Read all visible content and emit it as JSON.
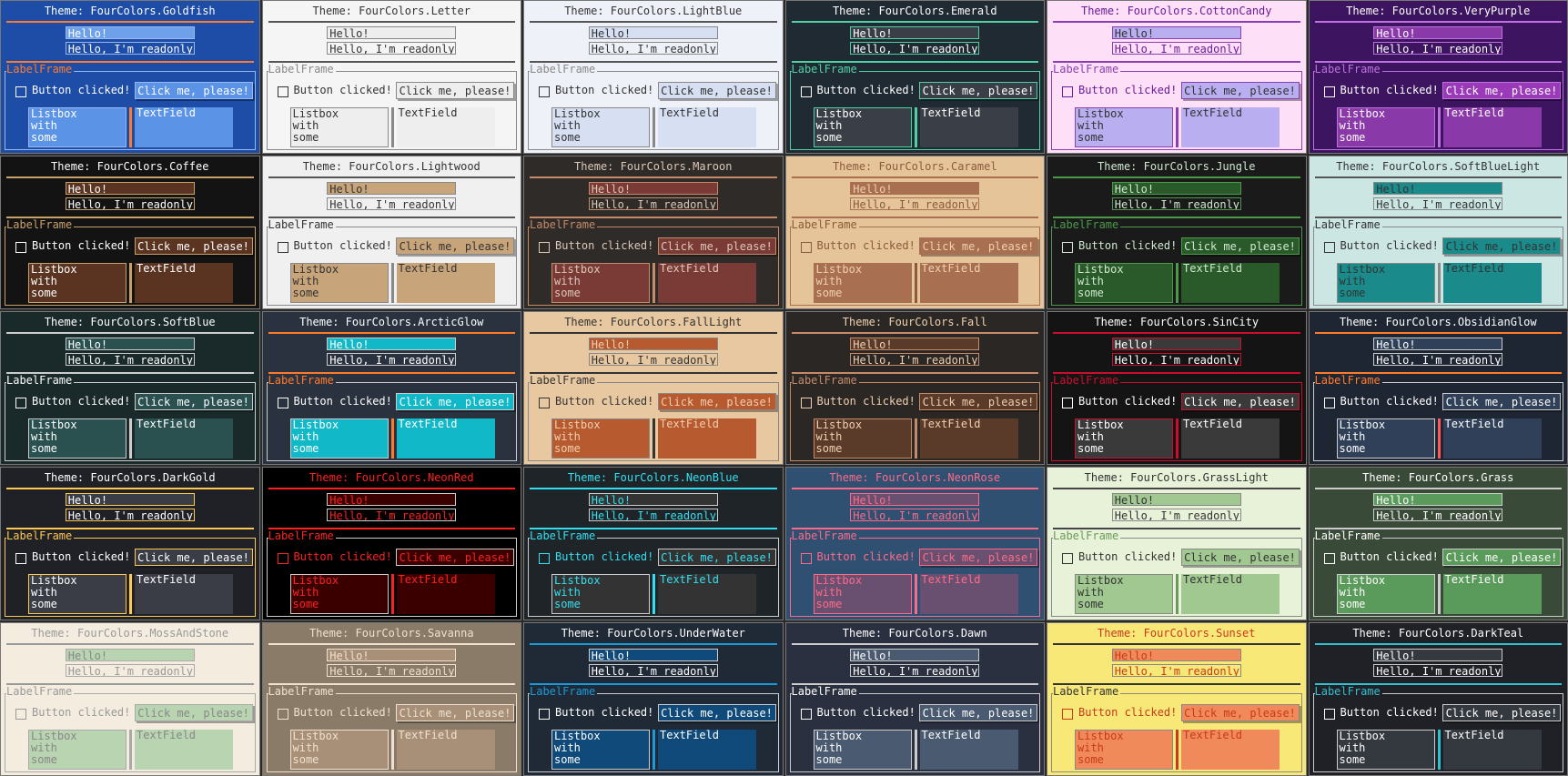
{
  "labels": {
    "title_prefix": "Theme: ",
    "hello": "Hello!",
    "readonly": "Hello, I'm readonly!",
    "label_frame": "LabelFrame",
    "checkbox": "Button clicked!",
    "button": "Click me, please!",
    "listbox_items": [
      "Listbox",
      "with",
      "some"
    ],
    "textfield": "TextField"
  },
  "themes": [
    {
      "name": "FourColors.Goldfish",
      "bg": "#1e4da8",
      "fg": "#ffffff",
      "accent": "#ff7a2a",
      "entry_bg": "#6fa0ea",
      "entry_fg": "#ffffff",
      "btn_bg": "#5b93e6",
      "btn_fg": "#ffffff",
      "list_bg": "#5b93e6",
      "list_fg": "#ffffff",
      "text_bg": "#5b93e6",
      "text_fg": "#ffffff",
      "frame": "#9ab8f0",
      "label": "#ff7a2a",
      "sep": "#ff7a2a"
    },
    {
      "name": "FourColors.Letter",
      "bg": "#f5f5f5",
      "fg": "#333333",
      "accent": "#555555",
      "entry_bg": "#eeeeee",
      "entry_fg": "#333333",
      "btn_bg": "#eeeeee",
      "btn_fg": "#333333",
      "list_bg": "#eeeeee",
      "list_fg": "#333333",
      "text_bg": "#eeeeee",
      "text_fg": "#333333",
      "frame": "#888888",
      "label": "#888888",
      "sep": "#888888"
    },
    {
      "name": "FourColors.LightBlue",
      "bg": "#eef1f8",
      "fg": "#333333",
      "accent": "#555555",
      "entry_bg": "#d6e0f2",
      "entry_fg": "#333333",
      "btn_bg": "#d6e0f2",
      "btn_fg": "#333333",
      "list_bg": "#d6e0f2",
      "list_fg": "#333333",
      "text_bg": "#d6e0f2",
      "text_fg": "#333333",
      "frame": "#888888",
      "label": "#888888",
      "sep": "#888888"
    },
    {
      "name": "FourColors.Emerald",
      "bg": "#1f2a33",
      "fg": "#ffffff",
      "accent": "#4fd1a5",
      "entry_bg": "#3a3f47",
      "entry_fg": "#ffffff",
      "btn_bg": "#3a3f47",
      "btn_fg": "#ffffff",
      "list_bg": "#3a3f47",
      "list_fg": "#ffffff",
      "text_bg": "#3a3f47",
      "text_fg": "#ffffff",
      "frame": "#4fd1a5",
      "label": "#4fd1a5",
      "sep": "#4fd1a5"
    },
    {
      "name": "FourColors.CottonCandy",
      "bg": "#fde0f8",
      "fg": "#6a1b9a",
      "accent": "#8a3fb0",
      "entry_bg": "#b8aef0",
      "entry_fg": "#333333",
      "btn_bg": "#b8aef0",
      "btn_fg": "#333333",
      "list_bg": "#b8aef0",
      "list_fg": "#333333",
      "text_bg": "#b8aef0",
      "text_fg": "#333333",
      "frame": "#8a3fb0",
      "label": "#8a3fb0",
      "sep": "#8a3fb0"
    },
    {
      "name": "FourColors.VeryPurple",
      "bg": "#3c1460",
      "fg": "#ffffff",
      "accent": "#c070e0",
      "entry_bg": "#8a3aa8",
      "entry_fg": "#ffffff",
      "btn_bg": "#9a3ab8",
      "btn_fg": "#ffffff",
      "list_bg": "#8a3aa8",
      "list_fg": "#ffffff",
      "text_bg": "#8a3aa8",
      "text_fg": "#ffffff",
      "frame": "#c070e0",
      "label": "#c070e0",
      "sep": "#c070e0"
    },
    {
      "name": "FourColors.Coffee",
      "bg": "#131313",
      "fg": "#ffffff",
      "accent": "#c8a06a",
      "entry_bg": "#5a3420",
      "entry_fg": "#ffffff",
      "btn_bg": "#5a3420",
      "btn_fg": "#ffffff",
      "list_bg": "#5a3420",
      "list_fg": "#ffffff",
      "text_bg": "#5a3420",
      "text_fg": "#ffffff",
      "frame": "#c8a06a",
      "label": "#c8a06a",
      "sep": "#c8a06a"
    },
    {
      "name": "FourColors.Lightwood",
      "bg": "#f0f0f0",
      "fg": "#333333",
      "accent": "#555555",
      "entry_bg": "#c8a47a",
      "entry_fg": "#333333",
      "btn_bg": "#c8a47a",
      "btn_fg": "#333333",
      "list_bg": "#c8a47a",
      "list_fg": "#333333",
      "text_bg": "#c8a47a",
      "text_fg": "#333333",
      "frame": "#888888",
      "label": "#333333",
      "sep": "#888888"
    },
    {
      "name": "FourColors.Maroon",
      "bg": "#2f2b28",
      "fg": "#dcc8b8",
      "accent": "#c48a6a",
      "entry_bg": "#7a3a36",
      "entry_fg": "#dcc8b8",
      "btn_bg": "#7a3a36",
      "btn_fg": "#dcc8b8",
      "list_bg": "#7a3a36",
      "list_fg": "#dcc8b8",
      "text_bg": "#7a3a36",
      "text_fg": "#dcc8b8",
      "frame": "#c48a6a",
      "label": "#c48a6a",
      "sep": "#c48a6a"
    },
    {
      "name": "FourColors.Caramel",
      "bg": "#e6c49a",
      "fg": "#8a5a3a",
      "accent": "#a87050",
      "entry_bg": "#a87050",
      "entry_fg": "#f0d0b0",
      "btn_bg": "#a87050",
      "btn_fg": "#f0d0b0",
      "list_bg": "#a87050",
      "list_fg": "#f0d0b0",
      "text_bg": "#a87050",
      "text_fg": "#f0d0b0",
      "frame": "#a87050",
      "label": "#8a5a3a",
      "sep": "#8a5a3a"
    },
    {
      "name": "FourColors.Jungle",
      "bg": "#1a1a1a",
      "fg": "#cfe8cf",
      "accent": "#4a9a4a",
      "entry_bg": "#2a5a2a",
      "entry_fg": "#cfe8cf",
      "btn_bg": "#2a5a2a",
      "btn_fg": "#cfe8cf",
      "list_bg": "#2a5a2a",
      "list_fg": "#cfe8cf",
      "text_bg": "#2a5a2a",
      "text_fg": "#cfe8cf",
      "frame": "#4a9a4a",
      "label": "#4a9a4a",
      "sep": "#4a9a4a"
    },
    {
      "name": "FourColors.SoftBlueLight",
      "bg": "#cce6e4",
      "fg": "#333333",
      "accent": "#555555",
      "entry_bg": "#1a8a8a",
      "entry_fg": "#333333",
      "btn_bg": "#1a8a8a",
      "btn_fg": "#333333",
      "list_bg": "#1a8a8a",
      "list_fg": "#333333",
      "text_bg": "#1a8a8a",
      "text_fg": "#333333",
      "frame": "#888888",
      "label": "#333333",
      "sep": "#888888"
    },
    {
      "name": "FourColors.SoftBlue",
      "bg": "#1a2a2a",
      "fg": "#ffffff",
      "accent": "#cccccc",
      "entry_bg": "#2a5050",
      "entry_fg": "#ffffff",
      "btn_bg": "#2a5050",
      "btn_fg": "#ffffff",
      "list_bg": "#2a5050",
      "list_fg": "#ffffff",
      "text_bg": "#2a5050",
      "text_fg": "#ffffff",
      "frame": "#cccccc",
      "label": "#ffffff",
      "sep": "#cccccc"
    },
    {
      "name": "FourColors.ArcticGlow",
      "bg": "#2a3240",
      "fg": "#ffffff",
      "accent": "#ff7a2a",
      "entry_bg": "#10b8c8",
      "entry_fg": "#ffffff",
      "btn_bg": "#10b8c8",
      "btn_fg": "#ffffff",
      "list_bg": "#10b8c8",
      "list_fg": "#ffffff",
      "text_bg": "#10b8c8",
      "text_fg": "#ffffff",
      "frame": "#cccccc",
      "label": "#ff7a2a",
      "sep": "#ff7a2a"
    },
    {
      "name": "FourColors.FallLight",
      "bg": "#e8c8a0",
      "fg": "#333333",
      "accent": "#333333",
      "entry_bg": "#b85a30",
      "entry_fg": "#f0d0b0",
      "btn_bg": "#b85a30",
      "btn_fg": "#f0d0b0",
      "list_bg": "#b85a30",
      "list_fg": "#f0d0b0",
      "text_bg": "#b85a30",
      "text_fg": "#f0d0b0",
      "frame": "#888888",
      "label": "#333333",
      "sep": "#333333"
    },
    {
      "name": "FourColors.Fall",
      "bg": "#2b2724",
      "fg": "#f0d0b0",
      "accent": "#c48a6a",
      "entry_bg": "#5a3a28",
      "entry_fg": "#f0d0b0",
      "btn_bg": "#5a3a28",
      "btn_fg": "#f0d0b0",
      "list_bg": "#5a3a28",
      "list_fg": "#f0d0b0",
      "text_bg": "#5a3a28",
      "text_fg": "#f0d0b0",
      "frame": "#c48a6a",
      "label": "#c48a6a",
      "sep": "#c48a6a"
    },
    {
      "name": "FourColors.SinCity",
      "bg": "#141414",
      "fg": "#ffffff",
      "accent": "#c8102e",
      "entry_bg": "#3a3a3a",
      "entry_fg": "#ffffff",
      "btn_bg": "#3a3a3a",
      "btn_fg": "#ffffff",
      "list_bg": "#3a3a3a",
      "list_fg": "#ffffff",
      "text_bg": "#3a3a3a",
      "text_fg": "#ffffff",
      "frame": "#c8102e",
      "label": "#c8102e",
      "sep": "#c8102e"
    },
    {
      "name": "FourColors.ObsidianGlow",
      "bg": "#1f2633",
      "fg": "#ffffff",
      "accent": "#ff7a2a",
      "entry_bg": "#2f4058",
      "entry_fg": "#ffffff",
      "btn_bg": "#2f4058",
      "btn_fg": "#ffffff",
      "list_bg": "#2f4058",
      "list_fg": "#ffffff",
      "text_bg": "#2f4058",
      "text_fg": "#ffffff",
      "frame": "#cccccc",
      "label": "#ff7a2a",
      "sep": "#ff5a5a"
    },
    {
      "name": "FourColors.DarkGold",
      "bg": "#1f2126",
      "fg": "#ffffff",
      "accent": "#ffc850",
      "entry_bg": "#3a3d45",
      "entry_fg": "#ffffff",
      "btn_bg": "#3a3d45",
      "btn_fg": "#ffffff",
      "list_bg": "#3a3d45",
      "list_fg": "#ffffff",
      "text_bg": "#3a3d45",
      "text_fg": "#ffffff",
      "frame": "#ffc850",
      "label": "#ffc850",
      "sep": "#ffc850"
    },
    {
      "name": "FourColors.NeonRed",
      "bg": "#000000",
      "fg": "#ff2020",
      "accent": "#ff2020",
      "entry_bg": "#3a0000",
      "entry_fg": "#ff2020",
      "btn_bg": "#3a0000",
      "btn_fg": "#ff2020",
      "list_bg": "#3a0000",
      "list_fg": "#ff2020",
      "text_bg": "#3a0000",
      "text_fg": "#ff2020",
      "frame": "#cccccc",
      "label": "#ff2020",
      "sep": "#ff2020"
    },
    {
      "name": "FourColors.NeonBlue",
      "bg": "#1f2429",
      "fg": "#30e0f0",
      "accent": "#30e0f0",
      "entry_bg": "#333333",
      "entry_fg": "#30e0f0",
      "btn_bg": "#333333",
      "btn_fg": "#30e0f0",
      "list_bg": "#333333",
      "list_fg": "#30e0f0",
      "text_bg": "#333333",
      "text_fg": "#30e0f0",
      "frame": "#cccccc",
      "label": "#30e0f0",
      "sep": "#30e0f0"
    },
    {
      "name": "FourColors.NeonRose",
      "bg": "#2f5070",
      "fg": "#ff6a8a",
      "accent": "#ff6a8a",
      "entry_bg": "#6a5070",
      "entry_fg": "#ff6a8a",
      "btn_bg": "#6a5070",
      "btn_fg": "#ff6a8a",
      "list_bg": "#6a5070",
      "list_fg": "#ff6a8a",
      "text_bg": "#6a5070",
      "text_fg": "#ff6a8a",
      "frame": "#ff6a8a",
      "label": "#ff6a8a",
      "sep": "#ff6a8a"
    },
    {
      "name": "FourColors.GrassLight",
      "bg": "#e8f2d8",
      "fg": "#333333",
      "accent": "#444444",
      "entry_bg": "#a0c890",
      "entry_fg": "#333333",
      "btn_bg": "#a0c890",
      "btn_fg": "#333333",
      "list_bg": "#a0c890",
      "list_fg": "#333333",
      "text_bg": "#a0c890",
      "text_fg": "#333333",
      "frame": "#888888",
      "label": "#6a9a5a",
      "sep": "#6a9a5a"
    },
    {
      "name": "FourColors.Grass",
      "bg": "#3a4a38",
      "fg": "#ffffff",
      "accent": "#cccccc",
      "entry_bg": "#5a9a5a",
      "entry_fg": "#ffffff",
      "btn_bg": "#5a9a5a",
      "btn_fg": "#ffffff",
      "list_bg": "#5a9a5a",
      "list_fg": "#ffffff",
      "text_bg": "#5a9a5a",
      "text_fg": "#ffffff",
      "frame": "#cccccc",
      "label": "#ffffff",
      "sep": "#cccccc"
    },
    {
      "name": "FourColors.MossAndStone",
      "bg": "#f5ece0",
      "fg": "#999999",
      "accent": "#999999",
      "entry_bg": "#b8d4b0",
      "entry_fg": "#888888",
      "btn_bg": "#b8d4b0",
      "btn_fg": "#888888",
      "list_bg": "#b8d4b0",
      "list_fg": "#888888",
      "text_bg": "#b8d4b0",
      "text_fg": "#888888",
      "frame": "#aaaaaa",
      "label": "#999999",
      "sep": "#aaaaaa"
    },
    {
      "name": "FourColors.Savanna",
      "bg": "#8a7a68",
      "fg": "#f0e0d0",
      "accent": "#f0e0d0",
      "entry_bg": "#a89078",
      "entry_fg": "#f0e0d0",
      "btn_bg": "#a89078",
      "btn_fg": "#f0e0d0",
      "list_bg": "#a89078",
      "list_fg": "#f0e0d0",
      "text_bg": "#a89078",
      "text_fg": "#f0e0d0",
      "frame": "#f0e0d0",
      "label": "#f0e0d0",
      "sep": "#f0e0d0"
    },
    {
      "name": "FourColors.UnderWater",
      "bg": "#1f2a36",
      "fg": "#ffffff",
      "accent": "#1a9ad8",
      "entry_bg": "#0f4a7a",
      "entry_fg": "#ffffff",
      "btn_bg": "#0f4a7a",
      "btn_fg": "#ffffff",
      "list_bg": "#0f4a7a",
      "list_fg": "#ffffff",
      "text_bg": "#0f4a7a",
      "text_fg": "#ffffff",
      "frame": "#cccccc",
      "label": "#1a9ad8",
      "sep": "#1a9ad8"
    },
    {
      "name": "FourColors.Dawn",
      "bg": "#2a3040",
      "fg": "#ffffff",
      "accent": "#cccccc",
      "entry_bg": "#4a5a70",
      "entry_fg": "#ffffff",
      "btn_bg": "#4a5a70",
      "btn_fg": "#ffffff",
      "list_bg": "#4a5a70",
      "list_fg": "#ffffff",
      "text_bg": "#4a5a70",
      "text_fg": "#ffffff",
      "frame": "#cccccc",
      "label": "#ffffff",
      "sep": "#cccccc"
    },
    {
      "name": "FourColors.Sunset",
      "bg": "#f8e878",
      "fg": "#c83a1a",
      "accent": "#333333",
      "entry_bg": "#f08a5a",
      "entry_fg": "#c83a1a",
      "btn_bg": "#f08a5a",
      "btn_fg": "#c83a1a",
      "list_bg": "#f08a5a",
      "list_fg": "#c83a1a",
      "text_bg": "#f08a5a",
      "text_fg": "#c83a1a",
      "frame": "#888888",
      "label": "#333333",
      "sep": "#c83a1a"
    },
    {
      "name": "FourColors.DarkTeal",
      "bg": "#1f2126",
      "fg": "#ffffff",
      "accent": "#30c0d0",
      "entry_bg": "#34383f",
      "entry_fg": "#ffffff",
      "btn_bg": "#34383f",
      "btn_fg": "#ffffff",
      "list_bg": "#34383f",
      "list_fg": "#ffffff",
      "text_bg": "#34383f",
      "text_fg": "#ffffff",
      "frame": "#cccccc",
      "label": "#30c0d0",
      "sep": "#30c0d0"
    }
  ]
}
